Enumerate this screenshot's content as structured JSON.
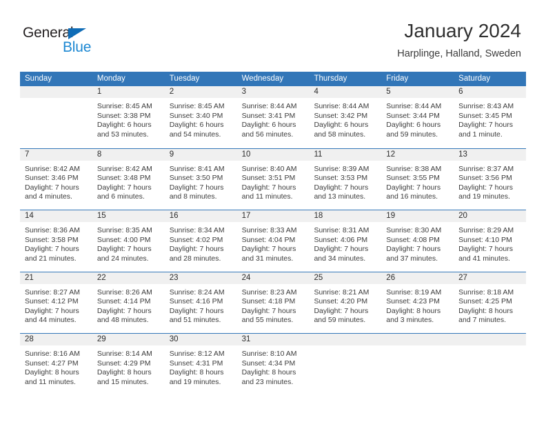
{
  "brand": {
    "word_one": "General",
    "word_two": "Blue",
    "accent_color": "#1b87d2",
    "triangle_color": "#0f6cb6",
    "logo_icon": "triangle-icon"
  },
  "header": {
    "title": "January 2024",
    "location": "Harplinge, Halland, Sweden"
  },
  "theme": {
    "header_bar": "#3276b8",
    "day_band": "#f0f0f0",
    "text": "#3b3b3b"
  },
  "weekdays": [
    "Sunday",
    "Monday",
    "Tuesday",
    "Wednesday",
    "Thursday",
    "Friday",
    "Saturday"
  ],
  "weeks": [
    [
      {
        "day": "",
        "lines": []
      },
      {
        "day": "1",
        "lines": [
          "Sunrise: 8:45 AM",
          "Sunset: 3:38 PM",
          "Daylight: 6 hours",
          "and 53 minutes."
        ]
      },
      {
        "day": "2",
        "lines": [
          "Sunrise: 8:45 AM",
          "Sunset: 3:40 PM",
          "Daylight: 6 hours",
          "and 54 minutes."
        ]
      },
      {
        "day": "3",
        "lines": [
          "Sunrise: 8:44 AM",
          "Sunset: 3:41 PM",
          "Daylight: 6 hours",
          "and 56 minutes."
        ]
      },
      {
        "day": "4",
        "lines": [
          "Sunrise: 8:44 AM",
          "Sunset: 3:42 PM",
          "Daylight: 6 hours",
          "and 58 minutes."
        ]
      },
      {
        "day": "5",
        "lines": [
          "Sunrise: 8:44 AM",
          "Sunset: 3:44 PM",
          "Daylight: 6 hours",
          "and 59 minutes."
        ]
      },
      {
        "day": "6",
        "lines": [
          "Sunrise: 8:43 AM",
          "Sunset: 3:45 PM",
          "Daylight: 7 hours",
          "and 1 minute."
        ]
      }
    ],
    [
      {
        "day": "7",
        "lines": [
          "Sunrise: 8:42 AM",
          "Sunset: 3:46 PM",
          "Daylight: 7 hours",
          "and 4 minutes."
        ]
      },
      {
        "day": "8",
        "lines": [
          "Sunrise: 8:42 AM",
          "Sunset: 3:48 PM",
          "Daylight: 7 hours",
          "and 6 minutes."
        ]
      },
      {
        "day": "9",
        "lines": [
          "Sunrise: 8:41 AM",
          "Sunset: 3:50 PM",
          "Daylight: 7 hours",
          "and 8 minutes."
        ]
      },
      {
        "day": "10",
        "lines": [
          "Sunrise: 8:40 AM",
          "Sunset: 3:51 PM",
          "Daylight: 7 hours",
          "and 11 minutes."
        ]
      },
      {
        "day": "11",
        "lines": [
          "Sunrise: 8:39 AM",
          "Sunset: 3:53 PM",
          "Daylight: 7 hours",
          "and 13 minutes."
        ]
      },
      {
        "day": "12",
        "lines": [
          "Sunrise: 8:38 AM",
          "Sunset: 3:55 PM",
          "Daylight: 7 hours",
          "and 16 minutes."
        ]
      },
      {
        "day": "13",
        "lines": [
          "Sunrise: 8:37 AM",
          "Sunset: 3:56 PM",
          "Daylight: 7 hours",
          "and 19 minutes."
        ]
      }
    ],
    [
      {
        "day": "14",
        "lines": [
          "Sunrise: 8:36 AM",
          "Sunset: 3:58 PM",
          "Daylight: 7 hours",
          "and 21 minutes."
        ]
      },
      {
        "day": "15",
        "lines": [
          "Sunrise: 8:35 AM",
          "Sunset: 4:00 PM",
          "Daylight: 7 hours",
          "and 24 minutes."
        ]
      },
      {
        "day": "16",
        "lines": [
          "Sunrise: 8:34 AM",
          "Sunset: 4:02 PM",
          "Daylight: 7 hours",
          "and 28 minutes."
        ]
      },
      {
        "day": "17",
        "lines": [
          "Sunrise: 8:33 AM",
          "Sunset: 4:04 PM",
          "Daylight: 7 hours",
          "and 31 minutes."
        ]
      },
      {
        "day": "18",
        "lines": [
          "Sunrise: 8:31 AM",
          "Sunset: 4:06 PM",
          "Daylight: 7 hours",
          "and 34 minutes."
        ]
      },
      {
        "day": "19",
        "lines": [
          "Sunrise: 8:30 AM",
          "Sunset: 4:08 PM",
          "Daylight: 7 hours",
          "and 37 minutes."
        ]
      },
      {
        "day": "20",
        "lines": [
          "Sunrise: 8:29 AM",
          "Sunset: 4:10 PM",
          "Daylight: 7 hours",
          "and 41 minutes."
        ]
      }
    ],
    [
      {
        "day": "21",
        "lines": [
          "Sunrise: 8:27 AM",
          "Sunset: 4:12 PM",
          "Daylight: 7 hours",
          "and 44 minutes."
        ]
      },
      {
        "day": "22",
        "lines": [
          "Sunrise: 8:26 AM",
          "Sunset: 4:14 PM",
          "Daylight: 7 hours",
          "and 48 minutes."
        ]
      },
      {
        "day": "23",
        "lines": [
          "Sunrise: 8:24 AM",
          "Sunset: 4:16 PM",
          "Daylight: 7 hours",
          "and 51 minutes."
        ]
      },
      {
        "day": "24",
        "lines": [
          "Sunrise: 8:23 AM",
          "Sunset: 4:18 PM",
          "Daylight: 7 hours",
          "and 55 minutes."
        ]
      },
      {
        "day": "25",
        "lines": [
          "Sunrise: 8:21 AM",
          "Sunset: 4:20 PM",
          "Daylight: 7 hours",
          "and 59 minutes."
        ]
      },
      {
        "day": "26",
        "lines": [
          "Sunrise: 8:19 AM",
          "Sunset: 4:23 PM",
          "Daylight: 8 hours",
          "and 3 minutes."
        ]
      },
      {
        "day": "27",
        "lines": [
          "Sunrise: 8:18 AM",
          "Sunset: 4:25 PM",
          "Daylight: 8 hours",
          "and 7 minutes."
        ]
      }
    ],
    [
      {
        "day": "28",
        "lines": [
          "Sunrise: 8:16 AM",
          "Sunset: 4:27 PM",
          "Daylight: 8 hours",
          "and 11 minutes."
        ]
      },
      {
        "day": "29",
        "lines": [
          "Sunrise: 8:14 AM",
          "Sunset: 4:29 PM",
          "Daylight: 8 hours",
          "and 15 minutes."
        ]
      },
      {
        "day": "30",
        "lines": [
          "Sunrise: 8:12 AM",
          "Sunset: 4:31 PM",
          "Daylight: 8 hours",
          "and 19 minutes."
        ]
      },
      {
        "day": "31",
        "lines": [
          "Sunrise: 8:10 AM",
          "Sunset: 4:34 PM",
          "Daylight: 8 hours",
          "and 23 minutes."
        ]
      },
      {
        "day": "",
        "lines": []
      },
      {
        "day": "",
        "lines": []
      },
      {
        "day": "",
        "lines": []
      }
    ]
  ]
}
